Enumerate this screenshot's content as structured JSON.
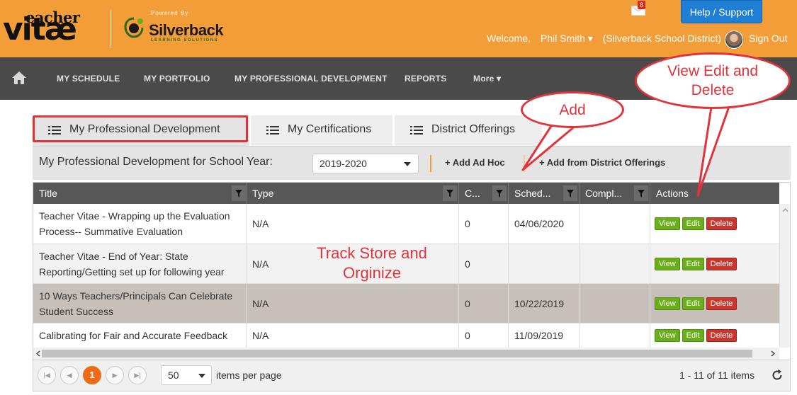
{
  "header": {
    "logo": {
      "teacher": "eacher",
      "vitae": "vitæ"
    },
    "partner": {
      "powered_by": "Powered By",
      "name": "Silverback",
      "tagline": "LEARNING SOLUTIONS"
    },
    "help_label": "Help / Support",
    "mail_count": "8",
    "welcome": "Welcome,",
    "user_name": "Phil Smith ▾",
    "district": "(Silverback School District)",
    "sign_out": "Sign Out",
    "colors": {
      "brand": "#f29d38",
      "nav": "#4a4a4a",
      "help": "#1f7fd4"
    }
  },
  "nav": {
    "items": [
      "MY SCHEDULE",
      "MY PORTFOLIO",
      "MY PROFESSIONAL DEVELOPMENT",
      "REPORTS",
      "More ▾"
    ]
  },
  "tabs": [
    {
      "label": "My Professional Development",
      "active": true
    },
    {
      "label": "My Certifications",
      "active": false
    },
    {
      "label": "District Offerings",
      "active": false
    }
  ],
  "toolbar": {
    "title": "My Professional Development for School Year:",
    "year": "2019-2020",
    "add_ad_hoc": "+ Add Ad Hoc",
    "add_from_district": "+ Add from District Offerings"
  },
  "grid": {
    "columns": [
      "Title",
      "Type",
      "C...",
      "Sched...",
      "Compl...",
      "Actions"
    ],
    "rows": [
      {
        "title": "Teacher Vitae - Wrapping up the Evaluation Process-- Summative Evaluation",
        "type": "N/A",
        "c": "0",
        "scheduled": "04/06/2020",
        "completed": ""
      },
      {
        "title": "Teacher Vitae - End of Year: State Reporting/Getting set up for following year",
        "type": "N/A",
        "c": "0",
        "scheduled": "",
        "completed": ""
      },
      {
        "title": "10 Ways Teachers/Principals Can Celebrate Student Success",
        "type": "N/A",
        "c": "0",
        "scheduled": "10/22/2019",
        "completed": ""
      },
      {
        "title": "Calibrating for Fair and Accurate Feedback",
        "type": "N/A",
        "c": "0",
        "scheduled": "11/09/2019",
        "completed": ""
      }
    ],
    "actions": {
      "view": "View",
      "edit": "Edit",
      "delete": "Delete"
    }
  },
  "pager": {
    "current_page": "1",
    "page_size": "50",
    "per_page_label": "items per page",
    "info": "1 - 11 of 11 items"
  },
  "annotations": {
    "view_edit_delete": "View Edit and Delete",
    "add": "Add",
    "track": "Track Store and Orginize"
  }
}
